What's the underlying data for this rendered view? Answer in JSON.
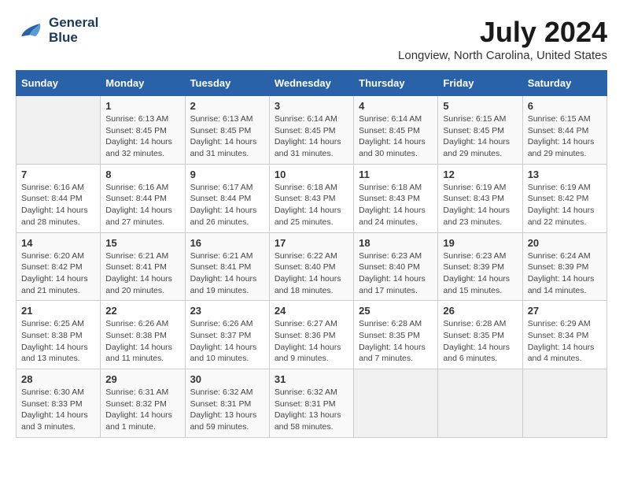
{
  "header": {
    "logo_line1": "General",
    "logo_line2": "Blue",
    "month_year": "July 2024",
    "location": "Longview, North Carolina, United States"
  },
  "calendar": {
    "days_of_week": [
      "Sunday",
      "Monday",
      "Tuesday",
      "Wednesday",
      "Thursday",
      "Friday",
      "Saturday"
    ],
    "weeks": [
      [
        {
          "day": "",
          "empty": true
        },
        {
          "day": "1",
          "sunrise": "Sunrise: 6:13 AM",
          "sunset": "Sunset: 8:45 PM",
          "daylight": "Daylight: 14 hours and 32 minutes."
        },
        {
          "day": "2",
          "sunrise": "Sunrise: 6:13 AM",
          "sunset": "Sunset: 8:45 PM",
          "daylight": "Daylight: 14 hours and 31 minutes."
        },
        {
          "day": "3",
          "sunrise": "Sunrise: 6:14 AM",
          "sunset": "Sunset: 8:45 PM",
          "daylight": "Daylight: 14 hours and 31 minutes."
        },
        {
          "day": "4",
          "sunrise": "Sunrise: 6:14 AM",
          "sunset": "Sunset: 8:45 PM",
          "daylight": "Daylight: 14 hours and 30 minutes."
        },
        {
          "day": "5",
          "sunrise": "Sunrise: 6:15 AM",
          "sunset": "Sunset: 8:45 PM",
          "daylight": "Daylight: 14 hours and 29 minutes."
        },
        {
          "day": "6",
          "sunrise": "Sunrise: 6:15 AM",
          "sunset": "Sunset: 8:44 PM",
          "daylight": "Daylight: 14 hours and 29 minutes."
        }
      ],
      [
        {
          "day": "7",
          "sunrise": "Sunrise: 6:16 AM",
          "sunset": "Sunset: 8:44 PM",
          "daylight": "Daylight: 14 hours and 28 minutes."
        },
        {
          "day": "8",
          "sunrise": "Sunrise: 6:16 AM",
          "sunset": "Sunset: 8:44 PM",
          "daylight": "Daylight: 14 hours and 27 minutes."
        },
        {
          "day": "9",
          "sunrise": "Sunrise: 6:17 AM",
          "sunset": "Sunset: 8:44 PM",
          "daylight": "Daylight: 14 hours and 26 minutes."
        },
        {
          "day": "10",
          "sunrise": "Sunrise: 6:18 AM",
          "sunset": "Sunset: 8:43 PM",
          "daylight": "Daylight: 14 hours and 25 minutes."
        },
        {
          "day": "11",
          "sunrise": "Sunrise: 6:18 AM",
          "sunset": "Sunset: 8:43 PM",
          "daylight": "Daylight: 14 hours and 24 minutes."
        },
        {
          "day": "12",
          "sunrise": "Sunrise: 6:19 AM",
          "sunset": "Sunset: 8:43 PM",
          "daylight": "Daylight: 14 hours and 23 minutes."
        },
        {
          "day": "13",
          "sunrise": "Sunrise: 6:19 AM",
          "sunset": "Sunset: 8:42 PM",
          "daylight": "Daylight: 14 hours and 22 minutes."
        }
      ],
      [
        {
          "day": "14",
          "sunrise": "Sunrise: 6:20 AM",
          "sunset": "Sunset: 8:42 PM",
          "daylight": "Daylight: 14 hours and 21 minutes."
        },
        {
          "day": "15",
          "sunrise": "Sunrise: 6:21 AM",
          "sunset": "Sunset: 8:41 PM",
          "daylight": "Daylight: 14 hours and 20 minutes."
        },
        {
          "day": "16",
          "sunrise": "Sunrise: 6:21 AM",
          "sunset": "Sunset: 8:41 PM",
          "daylight": "Daylight: 14 hours and 19 minutes."
        },
        {
          "day": "17",
          "sunrise": "Sunrise: 6:22 AM",
          "sunset": "Sunset: 8:40 PM",
          "daylight": "Daylight: 14 hours and 18 minutes."
        },
        {
          "day": "18",
          "sunrise": "Sunrise: 6:23 AM",
          "sunset": "Sunset: 8:40 PM",
          "daylight": "Daylight: 14 hours and 17 minutes."
        },
        {
          "day": "19",
          "sunrise": "Sunrise: 6:23 AM",
          "sunset": "Sunset: 8:39 PM",
          "daylight": "Daylight: 14 hours and 15 minutes."
        },
        {
          "day": "20",
          "sunrise": "Sunrise: 6:24 AM",
          "sunset": "Sunset: 8:39 PM",
          "daylight": "Daylight: 14 hours and 14 minutes."
        }
      ],
      [
        {
          "day": "21",
          "sunrise": "Sunrise: 6:25 AM",
          "sunset": "Sunset: 8:38 PM",
          "daylight": "Daylight: 14 hours and 13 minutes."
        },
        {
          "day": "22",
          "sunrise": "Sunrise: 6:26 AM",
          "sunset": "Sunset: 8:38 PM",
          "daylight": "Daylight: 14 hours and 11 minutes."
        },
        {
          "day": "23",
          "sunrise": "Sunrise: 6:26 AM",
          "sunset": "Sunset: 8:37 PM",
          "daylight": "Daylight: 14 hours and 10 minutes."
        },
        {
          "day": "24",
          "sunrise": "Sunrise: 6:27 AM",
          "sunset": "Sunset: 8:36 PM",
          "daylight": "Daylight: 14 hours and 9 minutes."
        },
        {
          "day": "25",
          "sunrise": "Sunrise: 6:28 AM",
          "sunset": "Sunset: 8:35 PM",
          "daylight": "Daylight: 14 hours and 7 minutes."
        },
        {
          "day": "26",
          "sunrise": "Sunrise: 6:28 AM",
          "sunset": "Sunset: 8:35 PM",
          "daylight": "Daylight: 14 hours and 6 minutes."
        },
        {
          "day": "27",
          "sunrise": "Sunrise: 6:29 AM",
          "sunset": "Sunset: 8:34 PM",
          "daylight": "Daylight: 14 hours and 4 minutes."
        }
      ],
      [
        {
          "day": "28",
          "sunrise": "Sunrise: 6:30 AM",
          "sunset": "Sunset: 8:33 PM",
          "daylight": "Daylight: 14 hours and 3 minutes."
        },
        {
          "day": "29",
          "sunrise": "Sunrise: 6:31 AM",
          "sunset": "Sunset: 8:32 PM",
          "daylight": "Daylight: 14 hours and 1 minute."
        },
        {
          "day": "30",
          "sunrise": "Sunrise: 6:32 AM",
          "sunset": "Sunset: 8:31 PM",
          "daylight": "Daylight: 13 hours and 59 minutes."
        },
        {
          "day": "31",
          "sunrise": "Sunrise: 6:32 AM",
          "sunset": "Sunset: 8:31 PM",
          "daylight": "Daylight: 13 hours and 58 minutes."
        },
        {
          "day": "",
          "empty": true
        },
        {
          "day": "",
          "empty": true
        },
        {
          "day": "",
          "empty": true
        }
      ]
    ]
  }
}
